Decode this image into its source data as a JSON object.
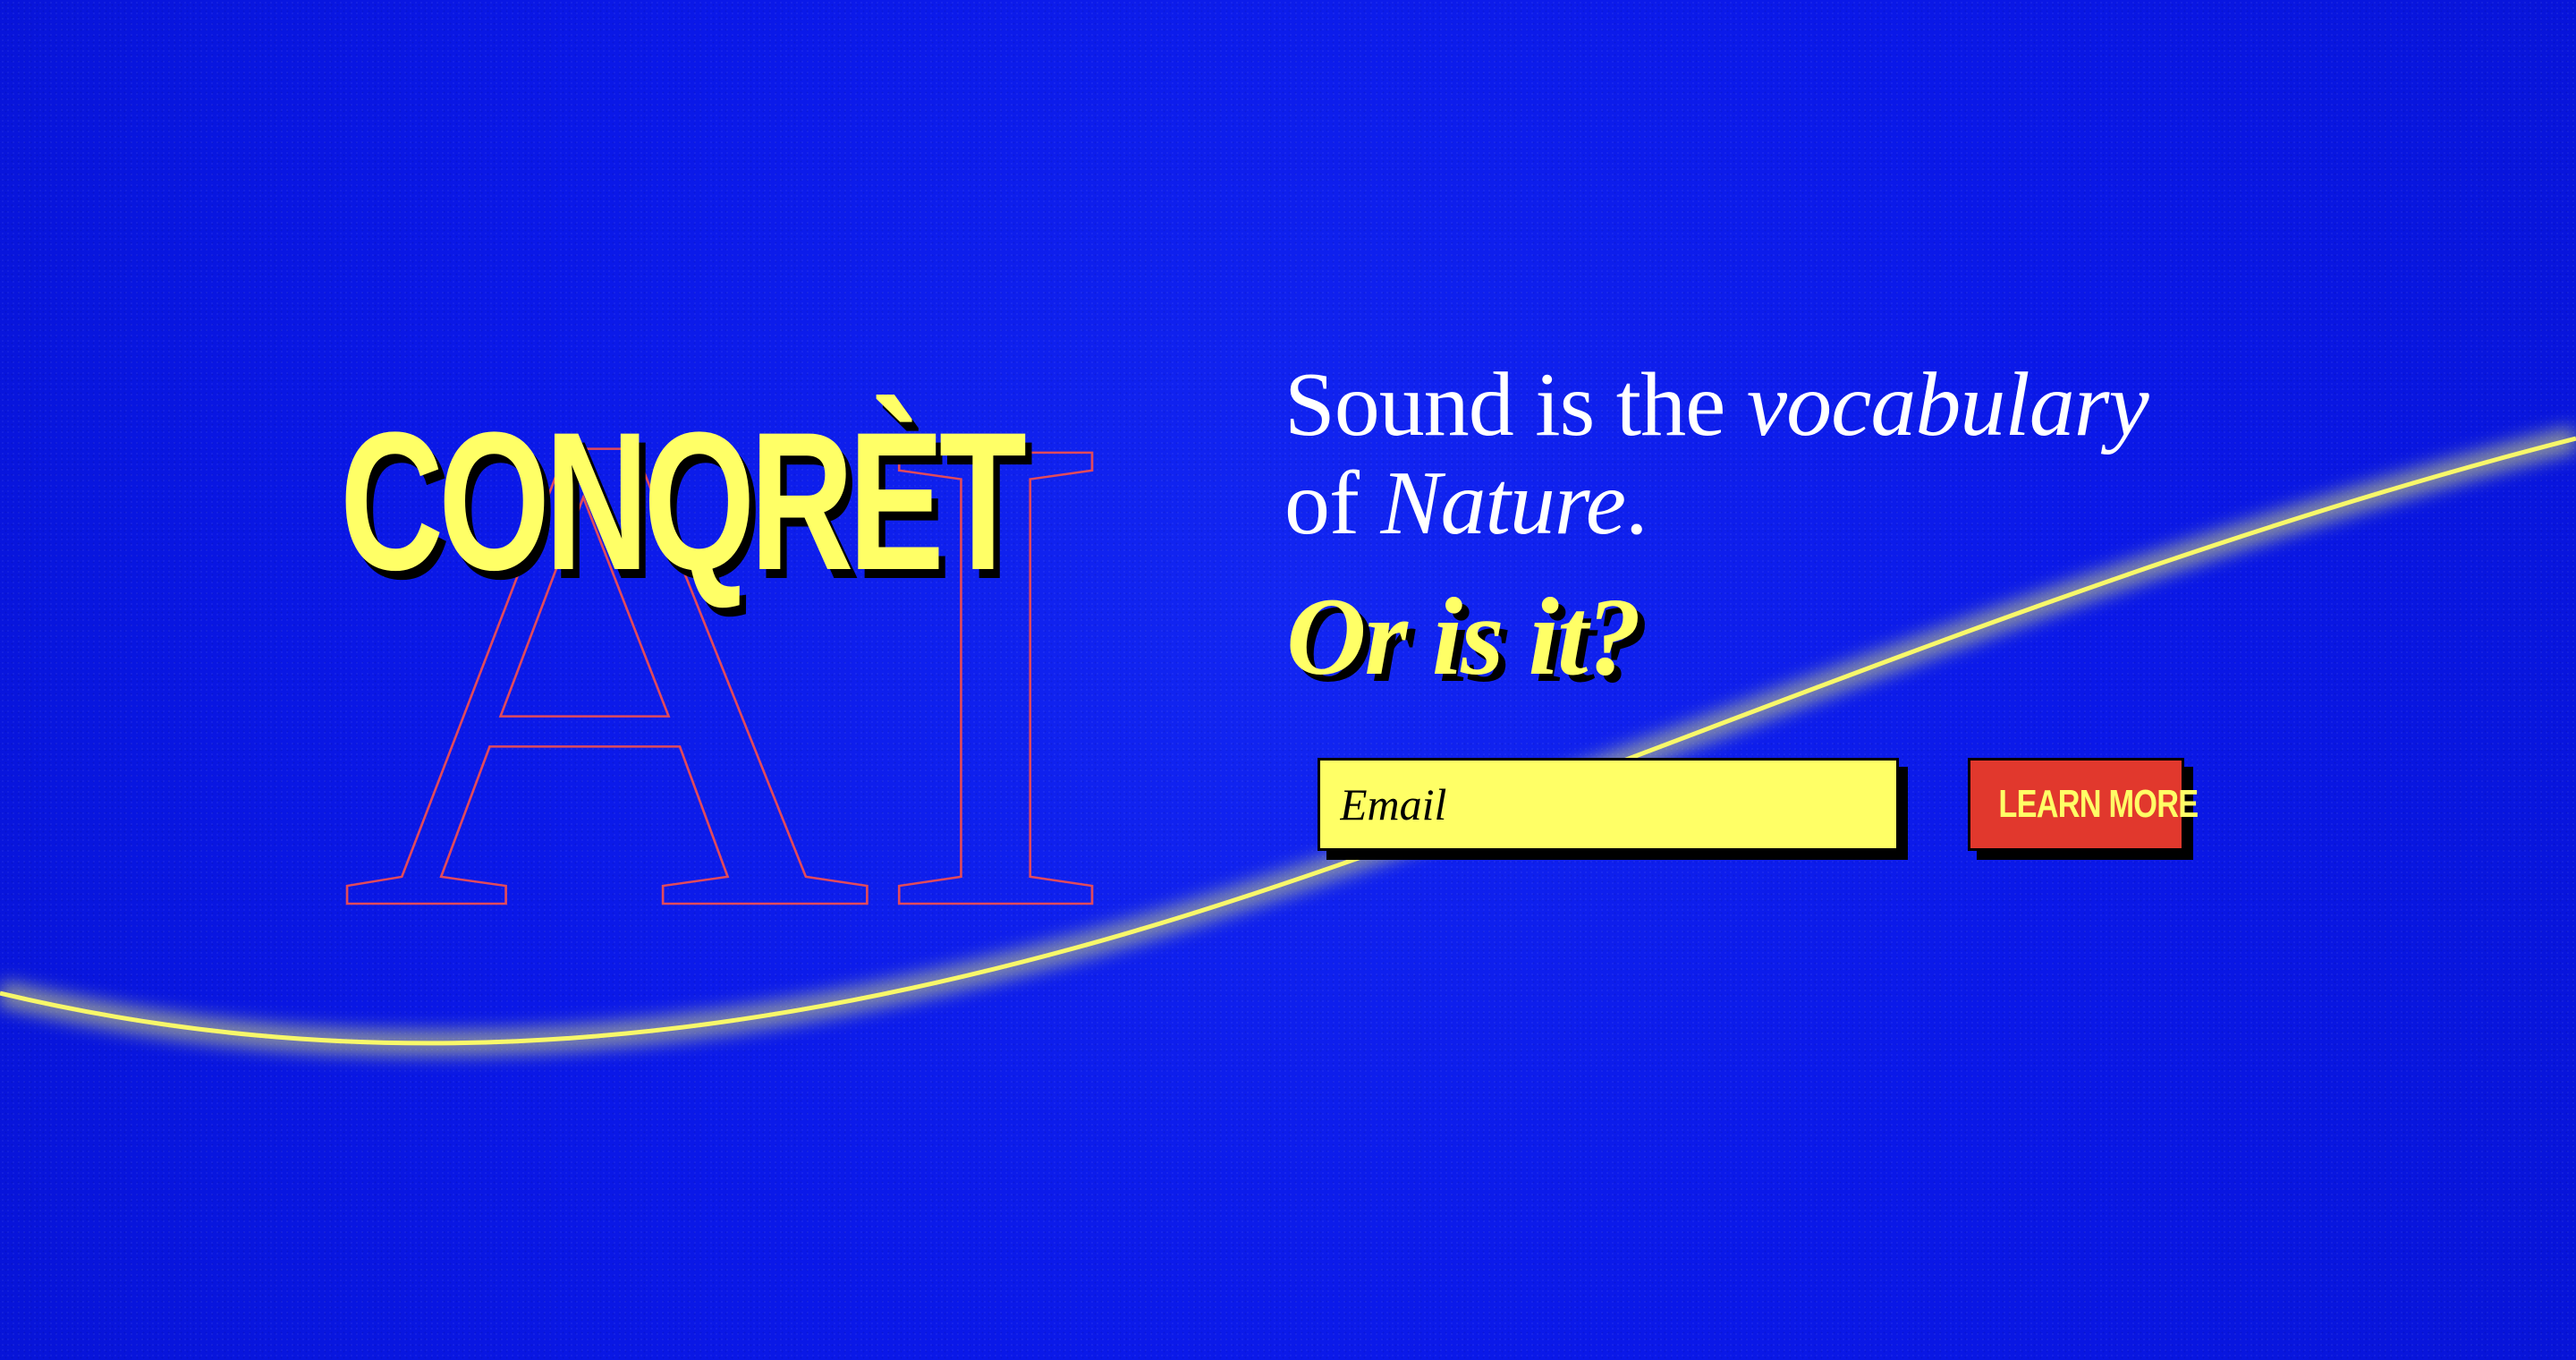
{
  "theme": {
    "background_color": "#0a18e8",
    "accent_yellow": "#ffff66",
    "accent_red": "#e1382d",
    "outline_red": "#e14a5b"
  },
  "brand": {
    "name": "CONQRÈT",
    "outline_text": "AI"
  },
  "hero": {
    "headline_part1": "Sound is the ",
    "headline_italic1": "vocabulary",
    "headline_part2": "of ",
    "headline_italic2": "Nature",
    "headline_part3": ".",
    "subheadline": "Or is it?"
  },
  "signup": {
    "email_placeholder": "Email",
    "email_value": "",
    "button_label": "LEARN MORE"
  }
}
